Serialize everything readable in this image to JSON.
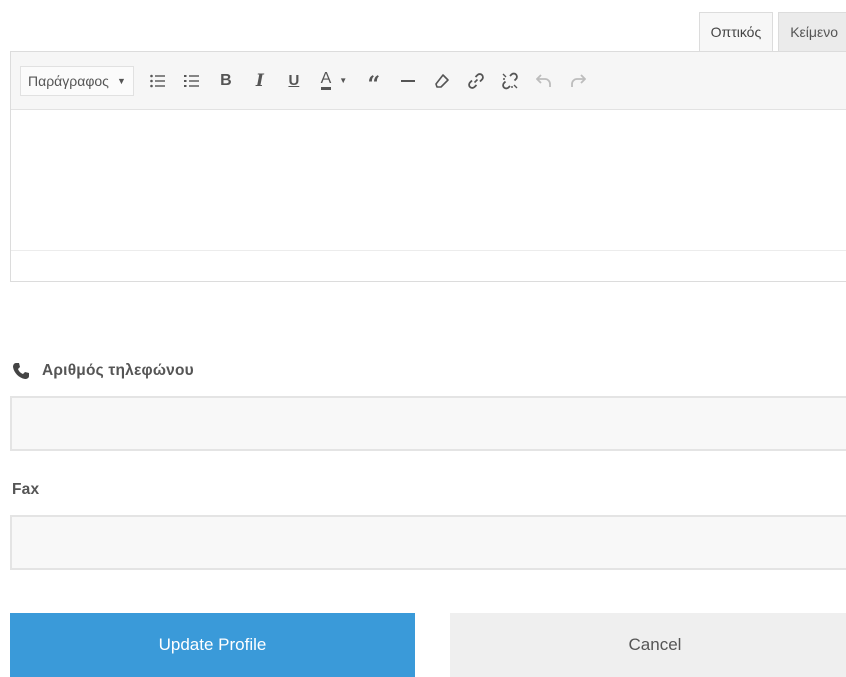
{
  "editor": {
    "tabs": {
      "visual": "Οπτικός",
      "text": "Κείμενο"
    },
    "toolbar": {
      "format_select": "Παράγραφος",
      "buttons": [
        {
          "name": "bullet-list",
          "icon": "bullet-list-icon"
        },
        {
          "name": "numbered-list",
          "icon": "numbered-list-icon"
        },
        {
          "name": "bold",
          "label": "B",
          "icon": "bold-icon"
        },
        {
          "name": "italic",
          "label": "I",
          "icon": "italic-icon"
        },
        {
          "name": "underline",
          "label": "U",
          "icon": "underline-icon"
        },
        {
          "name": "text-color",
          "label": "A",
          "icon": "text-color-icon"
        },
        {
          "name": "blockquote",
          "label": "66",
          "icon": "blockquote-icon"
        },
        {
          "name": "horizontal-line",
          "icon": "horizontal-line-icon"
        },
        {
          "name": "clear-formatting",
          "icon": "eraser-icon"
        },
        {
          "name": "insert-link",
          "icon": "link-icon"
        },
        {
          "name": "remove-link",
          "icon": "unlink-icon"
        },
        {
          "name": "undo",
          "icon": "undo-icon",
          "disabled": true
        },
        {
          "name": "redo",
          "icon": "redo-icon",
          "disabled": true
        }
      ]
    },
    "content": ""
  },
  "phone": {
    "label": "Αριθμός τηλεφώνου",
    "value": "",
    "icon": "phone-icon"
  },
  "fax": {
    "label": "Fax",
    "value": ""
  },
  "actions": {
    "update": "Update Profile",
    "cancel": "Cancel"
  },
  "colors": {
    "primary": "#3a9ad9",
    "secondary": "#efefef",
    "input_bg": "#f8f8f8"
  }
}
